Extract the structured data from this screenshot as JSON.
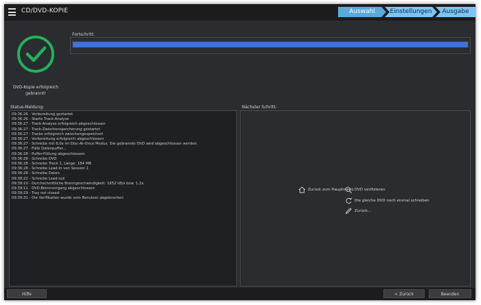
{
  "window": {
    "title": "CD/DVD-KOPIE"
  },
  "steps": [
    "Auswahl",
    "Einstellungen",
    "Ausgabe"
  ],
  "status": {
    "message": "DVD-Kopie erfolgreich gebrannt!",
    "accent_color": "#1fb35a"
  },
  "progress": {
    "label": "Fortschritt:",
    "value_percent": 100,
    "color": "#3c74d8"
  },
  "log": {
    "label": "Status-Meldung:",
    "lines": [
      "09:36:26 - Vorbereitung gestartet",
      "09:36:26 - Starte Track-Analyse",
      "09:36:27 - Track-Analyse erfolgreich abgeschlossen",
      "09:36:27 - Track-Zwischenspeicherung gestartet",
      "09:36:27 - Tracks erfolgreich zwischengespeichert",
      "09:36:27 - Vorbereitung erfolgreich abgeschlossen",
      "09:36:27 - Schreibe mit 6.0x im Disc-At-Once Modus. Die gebrannte DVD wird abgeschlossen werden.",
      "09:36:27 - Fülle Datenpuffer...",
      "09:36:28 - Puffer-Füllung abgeschlossen.",
      "09:36:28 - Schreibe DVD",
      "09:36:28 - Schreibe Track 1, Länge: 184 MB",
      "09:36:28 - Schreibe Lead-In von Session 1",
      "09:36:28 - Schreibe Daten",
      "09:38:22 - Schreibe Lead-out",
      "09:39:10 - Durchschnittliche Brenngeschwindigkeit: 1652 kB/s bzw.  1.2x.",
      "09:39:11 - DVD-Brennvorgang abgeschlossen",
      "09:39:29 - Tray not closed",
      "09:39:31 - Die Verifikation wurde vom Benutzer abgebrochen"
    ]
  },
  "next_step": {
    "label": "Nächster Schritt:",
    "actions": {
      "home": "Zurück zum Hauptmenü",
      "verify": "DVD verifizieren",
      "burn_again": "Die gleiche DVD noch einmal schreiben",
      "back": "Zurück..."
    }
  },
  "buttons": {
    "help": "Hilfe",
    "back": "< Zurück",
    "exit": "Beenden"
  }
}
